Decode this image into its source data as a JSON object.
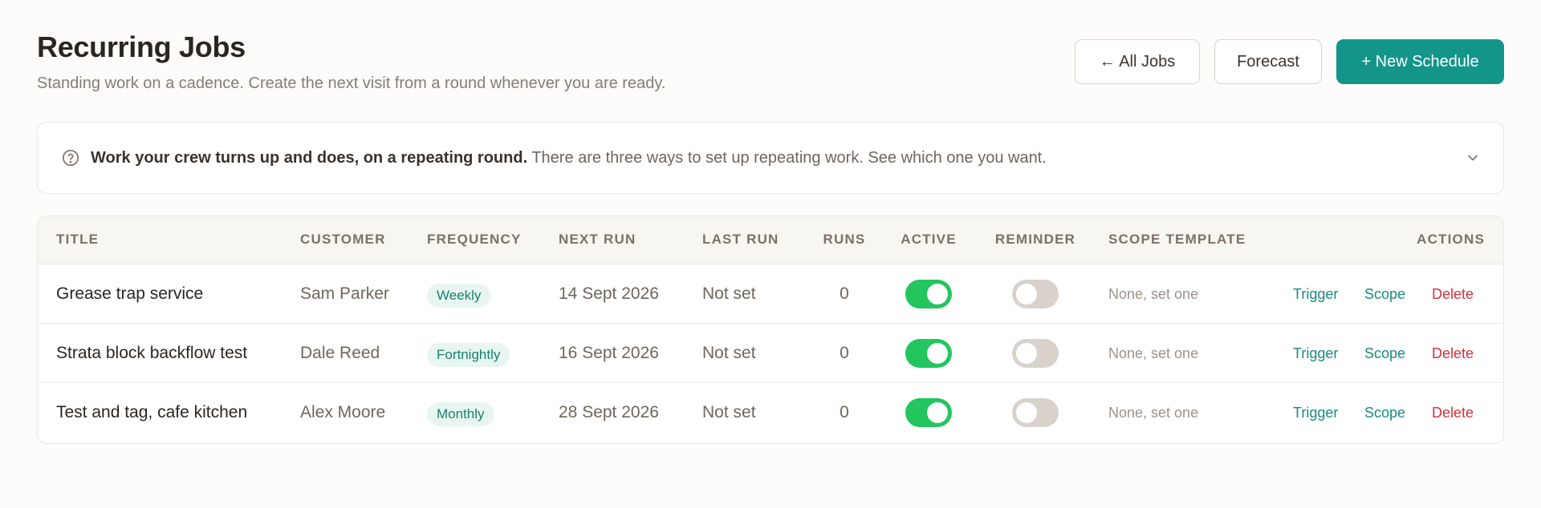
{
  "header": {
    "title": "Recurring Jobs",
    "subtitle": "Standing work on a cadence. Create the next visit from a round whenever you are ready.",
    "buttons": {
      "all_jobs": "← All Jobs",
      "forecast": "Forecast",
      "new_schedule": "+ New Schedule"
    }
  },
  "banner": {
    "icon": "help-circle-icon",
    "strong": "Work your crew turns up and does, on a repeating round.",
    "text": " There are three ways to set up repeating work. See which one you want.",
    "expand_icon": "chevron-down-icon"
  },
  "table": {
    "columns": {
      "title": "TITLE",
      "customer": "CUSTOMER",
      "frequency": "FREQUENCY",
      "next_run": "NEXT RUN",
      "last_run": "LAST RUN",
      "runs": "RUNS",
      "active": "ACTIVE",
      "reminder": "REMINDER",
      "scope_template": "SCOPE TEMPLATE",
      "actions": "ACTIONS"
    },
    "rows": [
      {
        "title": "Grease trap service",
        "customer": "Sam Parker",
        "frequency": "Weekly",
        "next_run": "14 Sept 2026",
        "last_run": "Not set",
        "runs": "0",
        "active": true,
        "reminder": false,
        "scope": "None, set one",
        "actions": {
          "trigger": "Trigger",
          "scope": "Scope",
          "delete": "Delete"
        }
      },
      {
        "title": "Strata block backflow test",
        "customer": "Dale Reed",
        "frequency": "Fortnightly",
        "next_run": "16 Sept 2026",
        "last_run": "Not set",
        "runs": "0",
        "active": true,
        "reminder": false,
        "scope": "None, set one",
        "actions": {
          "trigger": "Trigger",
          "scope": "Scope",
          "delete": "Delete"
        }
      },
      {
        "title": "Test and tag, cafe kitchen",
        "customer": "Alex Moore",
        "frequency": "Monthly",
        "next_run": "28 Sept 2026",
        "last_run": "Not set",
        "runs": "0",
        "active": true,
        "reminder": false,
        "scope": "None, set one",
        "actions": {
          "trigger": "Trigger",
          "scope": "Scope",
          "delete": "Delete"
        }
      }
    ]
  },
  "colors": {
    "primary": "#13958a",
    "toggle_on": "#22c55e",
    "toggle_off": "#d8d2cb",
    "delete": "#d4303a"
  }
}
